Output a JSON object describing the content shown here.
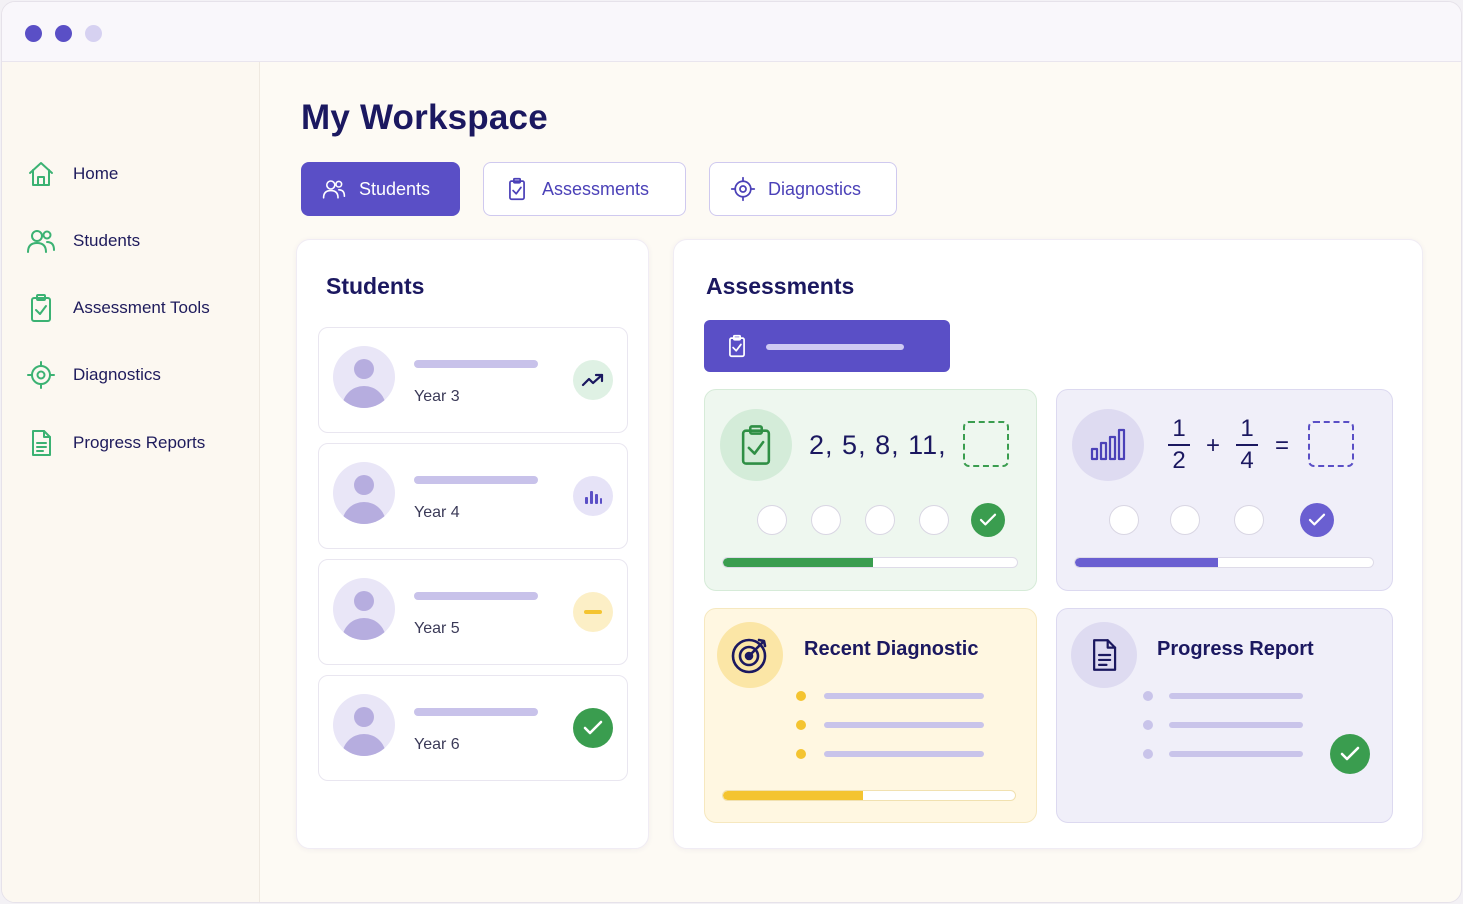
{
  "window": {
    "controls": [
      "close",
      "minimize",
      "maximize"
    ]
  },
  "sidebar": {
    "items": [
      {
        "label": "Home",
        "icon": "home-icon"
      },
      {
        "label": "Students",
        "icon": "users-icon"
      },
      {
        "label": "Assessment Tools",
        "icon": "clipboard-check-icon"
      },
      {
        "label": "Diagnostics",
        "icon": "target-icon"
      },
      {
        "label": "Progress Reports",
        "icon": "document-icon"
      }
    ],
    "icon_color": "#3bb273"
  },
  "header": {
    "title": "My Workspace"
  },
  "tabs": [
    {
      "label": "Students",
      "icon": "users-icon",
      "active": true
    },
    {
      "label": "Assessments",
      "icon": "clipboard-check-icon",
      "active": false
    },
    {
      "label": "Diagnostics",
      "icon": "target-icon",
      "active": false
    }
  ],
  "students_panel": {
    "title": "Students",
    "cards": [
      {
        "year": "Year 3",
        "status_icon": "trend-up-icon"
      },
      {
        "year": "Year 4",
        "status_icon": "bar-chart-icon"
      },
      {
        "year": "Year 5",
        "status_icon": "minus-icon"
      },
      {
        "year": "Year 6",
        "status_icon": "check-icon"
      }
    ]
  },
  "assessments_panel": {
    "title": "Assessments",
    "sequence_card": {
      "terms": [
        "2,",
        "5,",
        "8,",
        "11,"
      ],
      "options_count": 5,
      "selected_option": 5,
      "progress": 0.51,
      "accent": "#3a9d4f"
    },
    "fraction_card": {
      "fraction_a": {
        "num": "1",
        "den": "2"
      },
      "operator": "+",
      "fraction_b": {
        "num": "1",
        "den": "4"
      },
      "equals": "=",
      "options_count": 4,
      "selected_option": 4,
      "progress": 0.48,
      "accent": "#6a5fd1"
    },
    "diagnostic_card": {
      "title": "Recent Diagnostic",
      "progress": 0.48,
      "accent": "#f4c430"
    },
    "report_card": {
      "title": "Progress Report"
    }
  },
  "colors": {
    "primary": "#5a4fc6",
    "navy": "#1b1860",
    "success": "#3a9d4f",
    "warning": "#f4c430"
  }
}
